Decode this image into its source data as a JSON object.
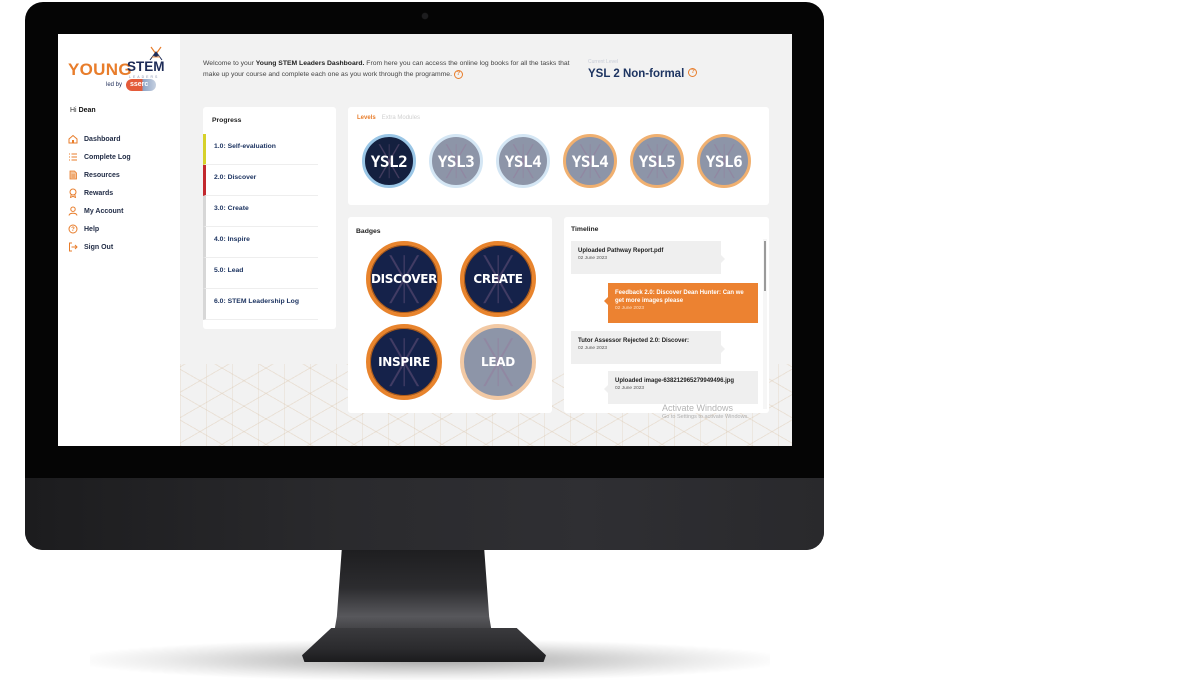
{
  "brand": {
    "logo_main": "YOUNG",
    "logo_accent": "STEM",
    "logo_sub": "LEADERS",
    "led_by": "led by",
    "partner": "sserc"
  },
  "user": {
    "greeting": "Hi",
    "name": "Dean"
  },
  "sidebar": {
    "items": [
      {
        "label": "Dashboard",
        "icon": "home-icon"
      },
      {
        "label": "Complete Log",
        "icon": "list-icon"
      },
      {
        "label": "Resources",
        "icon": "document-icon"
      },
      {
        "label": "Rewards",
        "icon": "award-icon"
      },
      {
        "label": "My Account",
        "icon": "user-icon"
      },
      {
        "label": "Help",
        "icon": "help-icon"
      },
      {
        "label": "Sign Out",
        "icon": "sign-out-icon"
      }
    ]
  },
  "header": {
    "welcome_prefix": "Welcome to your ",
    "welcome_bold": "Young STEM Leaders Dashboard.",
    "welcome_rest": " From here you can access the online log books for all the tasks that make up your course and complete each one as you work through the programme.",
    "help_symbol": "?",
    "current_level_label": "Current Level",
    "current_level": "YSL 2 Non-formal"
  },
  "progress": {
    "title": "Progress",
    "items": [
      {
        "label": "1.0: Self-evaluation",
        "status": "yellow"
      },
      {
        "label": "2.0: Discover",
        "status": "red"
      },
      {
        "label": "3.0: Create",
        "status": "none"
      },
      {
        "label": "4.0: Inspire",
        "status": "none"
      },
      {
        "label": "5.0: Lead",
        "status": "none"
      },
      {
        "label": "6.0: STEM Leadership Log",
        "status": "none"
      }
    ]
  },
  "levels": {
    "tabs": [
      {
        "label": "Levels",
        "active": true
      },
      {
        "label": "Extra Modules",
        "active": false
      }
    ],
    "items": [
      {
        "label": "YSL2",
        "state": "active"
      },
      {
        "label": "YSL3",
        "state": "locked-blue"
      },
      {
        "label": "YSL4",
        "state": "locked-blue"
      },
      {
        "label": "YSL4",
        "state": "locked-orange"
      },
      {
        "label": "YSL5",
        "state": "locked-orange"
      },
      {
        "label": "YSL6",
        "state": "locked-orange"
      }
    ]
  },
  "badges": {
    "title": "Badges",
    "items": [
      {
        "label": "DISCOVER",
        "earned": true
      },
      {
        "label": "CREATE",
        "earned": true
      },
      {
        "label": "INSPIRE",
        "earned": true
      },
      {
        "label": "LEAD",
        "earned": false
      }
    ]
  },
  "timeline": {
    "title": "Timeline",
    "items": [
      {
        "text": "Uploaded Pathway Report.pdf",
        "date": "02 June 2023",
        "side": "left",
        "highlight": false
      },
      {
        "text": "Feedback 2.0: Discover Dean Hunter: Can we get more images please",
        "date": "02 June 2023",
        "side": "right",
        "highlight": true
      },
      {
        "text": "Tutor Assessor Rejected 2.0: Discover:",
        "date": "02 June 2023",
        "side": "left",
        "highlight": false
      },
      {
        "text": "Uploaded image-638212965279949496.jpg",
        "date": "02 June 2023",
        "side": "right",
        "highlight": false
      }
    ]
  },
  "watermark": {
    "line1": "Activate Windows",
    "line2": "Go to Settings to activate Windows."
  },
  "colors": {
    "accent": "#e87d2b",
    "navy": "#1d3461",
    "progress_yellow": "#d6d12a",
    "progress_red": "#c2282d",
    "timeline_highlight": "#ec8231"
  }
}
